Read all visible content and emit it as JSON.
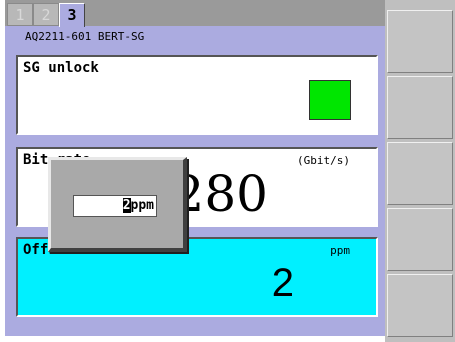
{
  "tabs": [
    {
      "label": "1",
      "active": false
    },
    {
      "label": "2",
      "active": false
    },
    {
      "label": "3",
      "active": true
    }
  ],
  "device_title": "AQ2211-601 BERT-SG",
  "cards": {
    "unlock": {
      "label": "SG unlock",
      "led_color": "#00e600"
    },
    "bitrate": {
      "label": "Bit rate",
      "unit": "(Gbit/s)",
      "value": "3280"
    },
    "offset": {
      "label": "Offset",
      "unit": "ppm",
      "value": "2"
    }
  },
  "popup": {
    "cursor_char": "2",
    "rest": "ppm"
  },
  "colors": {
    "panel": "#ababe0",
    "offset_bg": "#00f0ff",
    "led": "#00e600"
  }
}
